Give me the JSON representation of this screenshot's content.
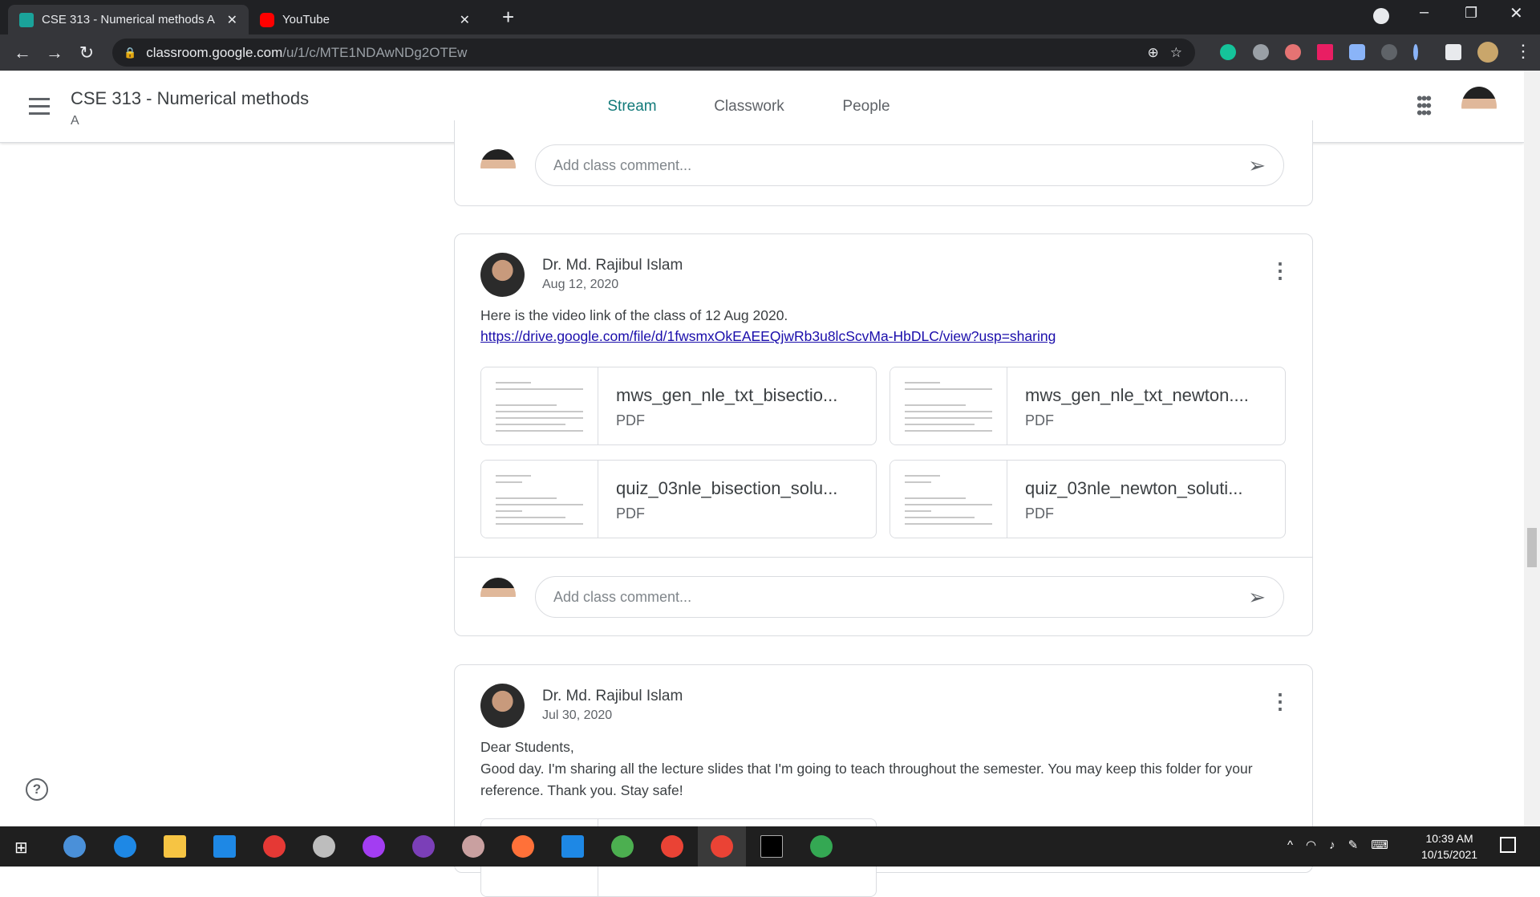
{
  "browser": {
    "tabs": [
      {
        "title": "CSE 313 - Numerical methods A",
        "active": true
      },
      {
        "title": "YouTube",
        "active": false
      }
    ],
    "url_host": "classroom.google.com",
    "url_path": "/u/1/c/MTE1NDAwNDg2OTEw"
  },
  "header": {
    "title": "CSE 313 - Numerical methods",
    "section": "A",
    "tabs": [
      "Stream",
      "Classwork",
      "People"
    ],
    "selected_tab": "Stream"
  },
  "comment_placeholder": "Add class comment...",
  "posts": [
    {
      "author": "Dr. Md. Rajibul Islam",
      "date": "Aug 12, 2020",
      "text": "Here is the video link of the class of 12 Aug 2020.",
      "link": "https://drive.google.com/file/d/1fwsmxOkEAEEQjwRb3u8lcScvMa-HbDLC/view?usp=sharing",
      "attachments": [
        {
          "name": "mws_gen_nle_txt_bisectio...",
          "type": "PDF"
        },
        {
          "name": "mws_gen_nle_txt_newton....",
          "type": "PDF"
        },
        {
          "name": "quiz_03nle_bisection_solu...",
          "type": "PDF"
        },
        {
          "name": "quiz_03nle_newton_soluti...",
          "type": "PDF"
        }
      ]
    },
    {
      "author": "Dr. Md. Rajibul Islam",
      "date": "Jul 30, 2020",
      "lines": [
        "Dear Students,",
        "Good day. I'm sharing all the lecture slides that I'm going to teach throughout the semester. You may keep this folder for your",
        "reference. Thank you. Stay safe!"
      ]
    }
  ],
  "taskbar": {
    "time": "10:39 AM",
    "date": "10/15/2021"
  },
  "colors": {
    "accent": "#127a7a",
    "link": "#1a0dab"
  }
}
